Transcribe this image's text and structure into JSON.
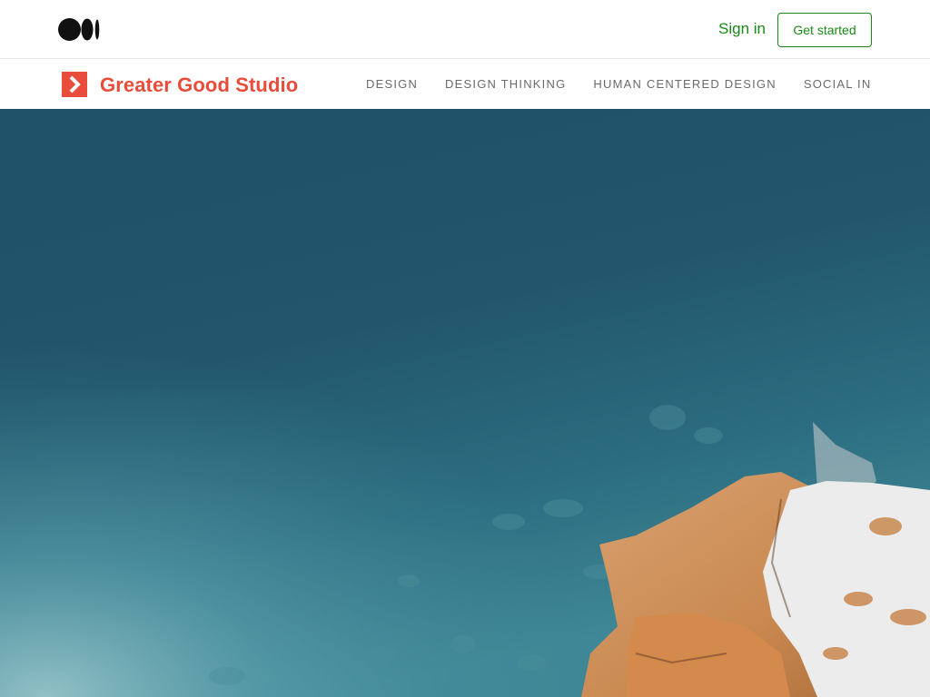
{
  "site": {
    "signin_label": "Sign in",
    "get_started_label": "Get started",
    "brand_color": "#1a8917",
    "logo_icon": "medium-logo-icon"
  },
  "publication": {
    "name": "Greater Good Studio",
    "logo_icon": "chevron-right-square-icon",
    "accent_color": "#ea4c3b",
    "nav": [
      {
        "label": "DESIGN"
      },
      {
        "label": "DESIGN THINKING"
      },
      {
        "label": "HUMAN CENTERED DESIGN"
      },
      {
        "label": "SOCIAL INNOVATION"
      }
    ]
  },
  "hero": {
    "image": "aerial-ocean-rocky-shore",
    "water_colors": [
      "#1e5068",
      "#2a6a80",
      "#5fa3af"
    ],
    "rock_colors": [
      "#c98a55",
      "#e8e8e8"
    ]
  }
}
